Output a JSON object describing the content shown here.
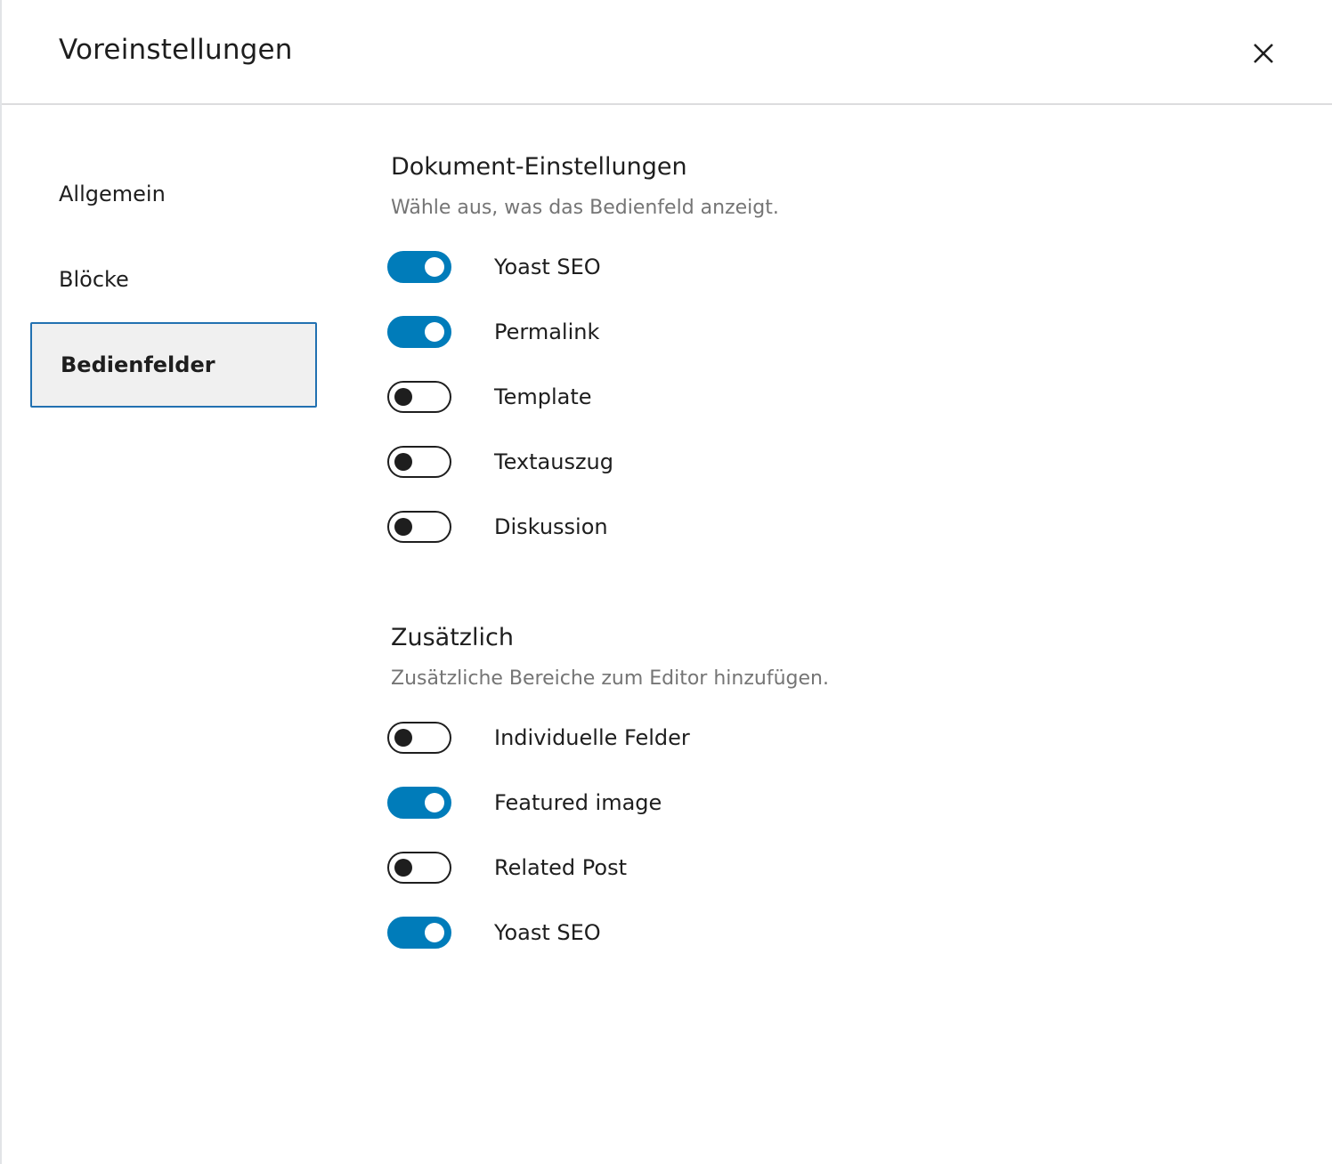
{
  "modal": {
    "title": "Voreinstellungen",
    "close_icon": "close-icon"
  },
  "sidebar": {
    "tabs": [
      {
        "label": "Allgemein",
        "active": false
      },
      {
        "label": "Blöcke",
        "active": false
      },
      {
        "label": "Bedienfelder",
        "active": true
      }
    ]
  },
  "sections": [
    {
      "title": "Dokument-Einstellungen",
      "description": "Wähle aus, was das Bedienfeld anzeigt.",
      "toggles": [
        {
          "label": "Yoast SEO",
          "checked": true
        },
        {
          "label": "Permalink",
          "checked": true
        },
        {
          "label": "Template",
          "checked": false
        },
        {
          "label": "Textauszug",
          "checked": false
        },
        {
          "label": "Diskussion",
          "checked": false
        }
      ]
    },
    {
      "title": "Zusätzlich",
      "description": "Zusätzliche Bereiche zum Editor hinzufügen.",
      "toggles": [
        {
          "label": "Individuelle Felder",
          "checked": false
        },
        {
          "label": "Featured image",
          "checked": true
        },
        {
          "label": "Related Post",
          "checked": false
        },
        {
          "label": "Yoast SEO",
          "checked": true
        }
      ]
    }
  ],
  "colors": {
    "accent": "#007cba",
    "active_tab_border": "#2271b1",
    "active_tab_bg": "#f0f0f0",
    "text": "#1e1e1e",
    "muted_text": "#757575"
  }
}
